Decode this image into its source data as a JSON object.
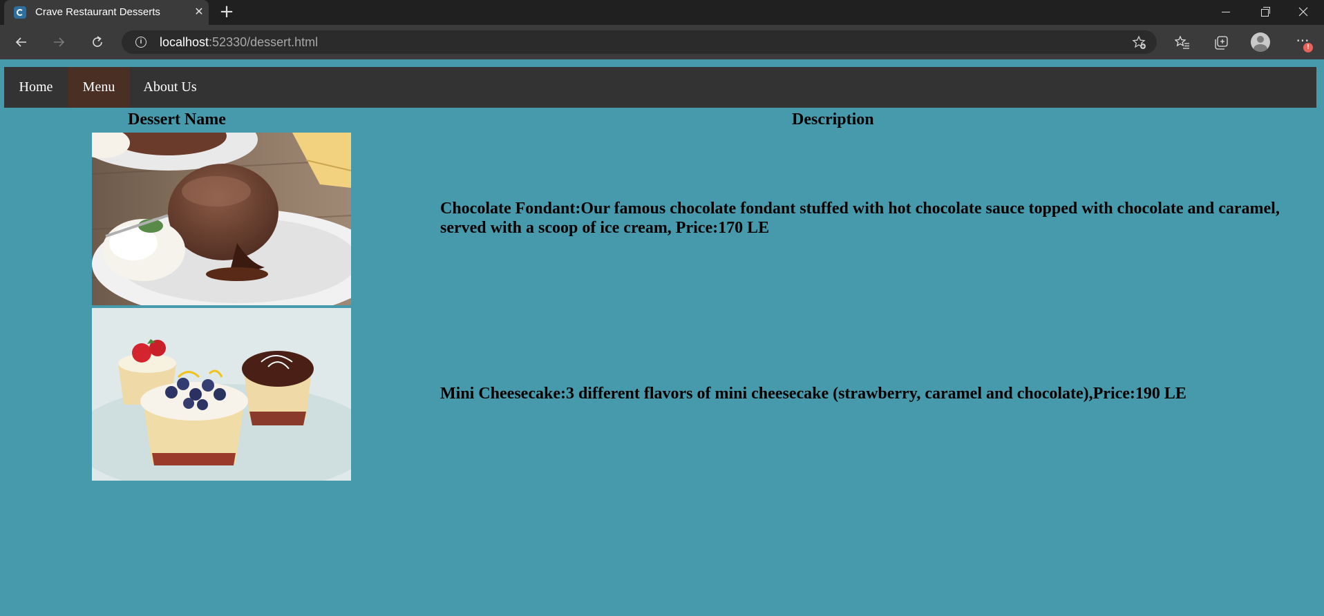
{
  "browser": {
    "tab_title": "Crave Restaurant Desserts",
    "url_host": "localhost",
    "url_rest": ":52330/dessert.html",
    "new_tab_label": "+",
    "close_tab_label": "✕",
    "more_label": "···",
    "alert_badge": "!"
  },
  "nav": {
    "items": [
      {
        "label": "Home"
      },
      {
        "label": "Menu"
      },
      {
        "label": "About Us"
      }
    ],
    "active": "Menu"
  },
  "table": {
    "headers": {
      "name": "Dessert Name",
      "description": "Description"
    },
    "rows": [
      {
        "image": "chocolate-fondant-image",
        "description": "Chocolate Fondant:Our famous chocolate fondant stuffed with hot chocolate sauce topped with chocolate and caramel, served with a scoop of ice cream, Price:170 LE"
      },
      {
        "image": "mini-cheesecake-image",
        "description": "Mini Cheesecake:3 different flavors of mini cheesecake (strawberry, caramel and chocolate),Price:190 LE"
      }
    ]
  },
  "colors": {
    "page_background": "#479aab",
    "nav_background": "#333333",
    "nav_active": "#4a2f25"
  }
}
